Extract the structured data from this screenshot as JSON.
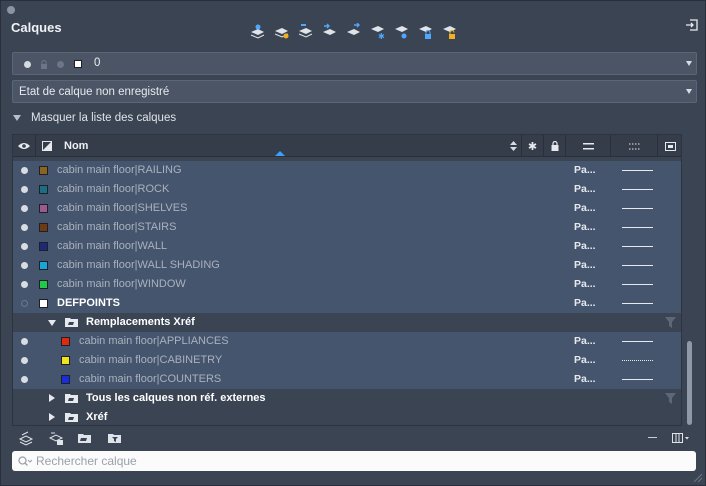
{
  "palette": {
    "title": "Calques"
  },
  "toolbar": {
    "tools": [
      {
        "icon": "new-layer-icon"
      },
      {
        "icon": "new-layer-frozen-icon"
      },
      {
        "icon": "delete-layer-icon"
      },
      {
        "icon": "set-current-icon"
      },
      {
        "icon": "layer-states-icon"
      },
      {
        "icon": "freeze-layer-icon"
      },
      {
        "icon": "isolate-layer-icon"
      },
      {
        "icon": "lock-layer-icon"
      },
      {
        "icon": "unlock-layer-icon"
      }
    ]
  },
  "current_layer": {
    "name": "0",
    "color": "#ffffff"
  },
  "layer_state": {
    "value": "Etat de calque non enregistré"
  },
  "list_toggle": {
    "label": "Masquer la liste des calques"
  },
  "columns": {
    "name": "Nom"
  },
  "layers_top": [
    {
      "name": "cabin main floor|RAILING",
      "color": "#8a6420",
      "plot": "Pa...",
      "linetype": "solid",
      "visible": true
    },
    {
      "name": "cabin main floor|ROCK",
      "color": "#1c6f82",
      "plot": "Pa...",
      "linetype": "solid",
      "visible": true
    },
    {
      "name": "cabin main floor|SHELVES",
      "color": "#9c5a8e",
      "plot": "Pa...",
      "linetype": "solid",
      "visible": true
    },
    {
      "name": "cabin main floor|STAIRS",
      "color": "#6e3a14",
      "plot": "Pa...",
      "linetype": "solid",
      "visible": true
    },
    {
      "name": "cabin main floor|WALL",
      "color": "#1e2a78",
      "plot": "Pa...",
      "linetype": "solid",
      "visible": true
    },
    {
      "name": "cabin main floor|WALL SHADING",
      "color": "#18a6d8",
      "plot": "Pa...",
      "linetype": "solid",
      "visible": true
    },
    {
      "name": "cabin main floor|WINDOW",
      "color": "#22c84a",
      "plot": "Pa...",
      "linetype": "solid",
      "visible": true
    },
    {
      "name": "DEFPOINTS",
      "color": "#ffffff",
      "plot": "Pa...",
      "linetype": "solid",
      "visible": false
    }
  ],
  "group_overrides": {
    "label": "Remplacements Xréf"
  },
  "layers_override": [
    {
      "name": "cabin main floor|APPLIANCES",
      "color": "#e02a10",
      "plot": "Pa...",
      "linetype": "solid"
    },
    {
      "name": "cabin main floor|CABINETRY",
      "color": "#f2e21a",
      "plot": "Pa...",
      "linetype": "dotted"
    },
    {
      "name": "cabin main floor|COUNTERS",
      "color": "#1a2ed8",
      "plot": "Pa...",
      "linetype": "solid"
    }
  ],
  "group_all_non_xref": {
    "label": "Tous les calques non réf. externes"
  },
  "group_xref": {
    "label": "Xréf"
  },
  "search": {
    "placeholder": "Rechercher calque"
  }
}
